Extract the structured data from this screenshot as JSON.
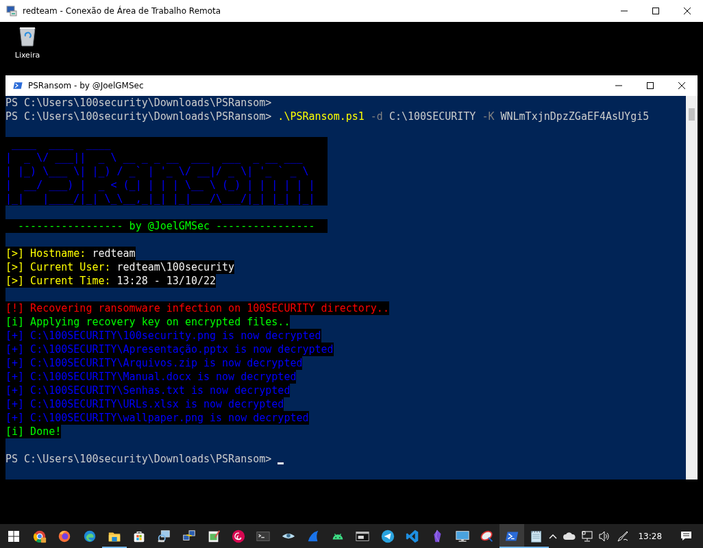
{
  "rdp_window": {
    "title": "redteam - Conexão de Área de Trabalho Remota"
  },
  "desktop": {
    "icons": [
      {
        "label": "Lixeira"
      }
    ]
  },
  "console_window": {
    "title": "PSRansom - by @JoelGMSec",
    "lines": [
      {
        "kind": "text",
        "highlighted": false,
        "segments": [
          {
            "text": "PS C:\\Users\\100security\\Downloads\\PSRansom>",
            "kind": "plain"
          }
        ]
      },
      {
        "kind": "text",
        "highlighted": false,
        "segments": [
          {
            "text": "PS C:\\Users\\100security\\Downloads\\PSRansom> ",
            "kind": "plain"
          },
          {
            "text": ".\\PSRansom.ps1",
            "kind": "command"
          },
          {
            "text": " -d ",
            "kind": "parameter"
          },
          {
            "text": "C:\\100SECURITY",
            "kind": "plain"
          },
          {
            "text": " -K ",
            "kind": "parameter"
          },
          {
            "text": "WNLmTxjnDpzZGaEF4AsUYgi5",
            "kind": "plain"
          }
        ]
      },
      {
        "kind": "blank"
      },
      {
        "kind": "banner",
        "art": [
          " ____  ____  ____",
          "|  _ \\/ ___||  _ \\ __ _ _ __  ___  ___  _ __ ___",
          "| |_) \\___ \\| |_) / _` | '_ \\/ __|/ _ \\| '_ ` _ \\",
          "|  __/ ___) |  _ < (_| | | | \\__ \\ (_) | | | | | |",
          "|_|   |____/|_| \\_\\__,_|_| |_|___/\\___/|_| |_| |_|"
        ]
      },
      {
        "kind": "blank"
      },
      {
        "kind": "byline",
        "highlighted": true,
        "segments": [
          {
            "text": "  ----------------- by @JoelGMSec ----------------",
            "kind": "success"
          }
        ]
      },
      {
        "kind": "blank"
      },
      {
        "kind": "text",
        "highlighted": true,
        "segments": [
          {
            "text": "[>] Hostname: ",
            "kind": "label"
          },
          {
            "text": "redteam",
            "kind": "value"
          }
        ]
      },
      {
        "kind": "text",
        "highlighted": true,
        "segments": [
          {
            "text": "[>] Current User: ",
            "kind": "label"
          },
          {
            "text": "redteam\\100security",
            "kind": "value"
          }
        ]
      },
      {
        "kind": "text",
        "highlighted": true,
        "segments": [
          {
            "text": "[>] Current Time: ",
            "kind": "label"
          },
          {
            "text": "13:28 - 13/10/22",
            "kind": "value"
          }
        ]
      },
      {
        "kind": "blank"
      },
      {
        "kind": "text",
        "highlighted": true,
        "segments": [
          {
            "text": "[!] Recovering ransomware infection on 100SECURITY directory..",
            "kind": "error"
          }
        ]
      },
      {
        "kind": "text",
        "highlighted": true,
        "segments": [
          {
            "text": "[i] Applying recovery key on encrypted files..",
            "kind": "success"
          }
        ]
      },
      {
        "kind": "text",
        "highlighted": true,
        "segments": [
          {
            "text": "[+] C:\\100SECURITY\\100security.png is now decrypted",
            "kind": "file"
          }
        ]
      },
      {
        "kind": "text",
        "highlighted": true,
        "segments": [
          {
            "text": "[+] C:\\100SECURITY\\Apresentação.pptx is now decrypted",
            "kind": "file"
          }
        ]
      },
      {
        "kind": "text",
        "highlighted": true,
        "segments": [
          {
            "text": "[+] C:\\100SECURITY\\Arquivos.zip is now decrypted",
            "kind": "file"
          }
        ]
      },
      {
        "kind": "text",
        "highlighted": true,
        "segments": [
          {
            "text": "[+] C:\\100SECURITY\\Manual.docx is now decrypted",
            "kind": "file"
          }
        ]
      },
      {
        "kind": "text",
        "highlighted": true,
        "segments": [
          {
            "text": "[+] C:\\100SECURITY\\Senhas.txt is now decrypted",
            "kind": "file"
          }
        ]
      },
      {
        "kind": "text",
        "highlighted": true,
        "segments": [
          {
            "text": "[+] C:\\100SECURITY\\URLs.xlsx is now decrypted",
            "kind": "file"
          }
        ]
      },
      {
        "kind": "text",
        "highlighted": true,
        "segments": [
          {
            "text": "[+] C:\\100SECURITY\\wallpaper.png is now decrypted",
            "kind": "file"
          }
        ]
      },
      {
        "kind": "text",
        "highlighted": true,
        "segments": [
          {
            "text": "[i] Done!",
            "kind": "success"
          }
        ]
      },
      {
        "kind": "blank"
      },
      {
        "kind": "prompt",
        "highlighted": false,
        "segments": [
          {
            "text": "PS C:\\Users\\100security\\Downloads\\PSRansom>",
            "kind": "plain"
          }
        ]
      }
    ]
  },
  "taskbar": {
    "apps": [
      {
        "running": false,
        "selected": false
      },
      {
        "running": false,
        "selected": false
      },
      {
        "running": false,
        "selected": false
      },
      {
        "running": true,
        "selected": false
      },
      {
        "running": false,
        "selected": false
      },
      {
        "running": false,
        "selected": false
      },
      {
        "running": false,
        "selected": false
      },
      {
        "running": false,
        "selected": false
      },
      {
        "running": false,
        "selected": false
      },
      {
        "running": false,
        "selected": false
      },
      {
        "running": false,
        "selected": false
      },
      {
        "running": false,
        "selected": false
      },
      {
        "running": false,
        "selected": false
      },
      {
        "running": false,
        "selected": false
      },
      {
        "running": false,
        "selected": false
      },
      {
        "running": false,
        "selected": false
      },
      {
        "running": false,
        "selected": false
      },
      {
        "running": false,
        "selected": false
      },
      {
        "running": false,
        "selected": false
      },
      {
        "running": true,
        "selected": true
      },
      {
        "running": true,
        "selected": false
      }
    ],
    "clock": "13:28"
  }
}
